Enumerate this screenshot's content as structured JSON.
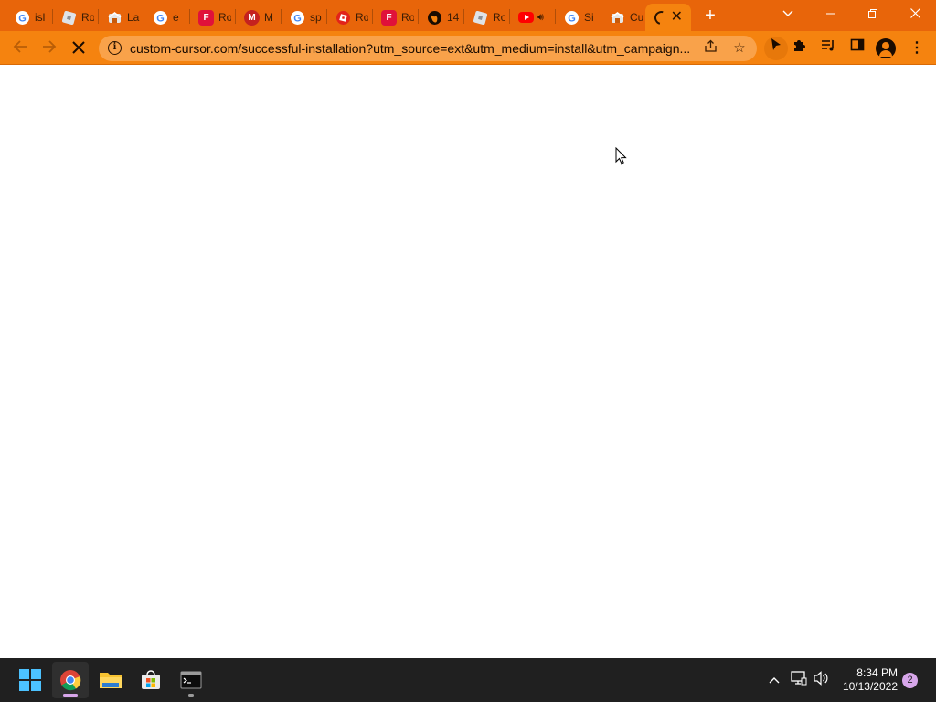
{
  "browser": {
    "tabs": [
      {
        "icon": "google-icon",
        "title": "isl"
      },
      {
        "icon": "roblox-icon",
        "title": "Ro"
      },
      {
        "icon": "extension-page-icon",
        "title": "La"
      },
      {
        "icon": "google-icon",
        "title": "e"
      },
      {
        "icon": "fandom-icon",
        "title": "Ro"
      },
      {
        "icon": "gmail-icon",
        "title": "M"
      },
      {
        "icon": "google-icon",
        "title": "sp"
      },
      {
        "icon": "roblox-red-icon",
        "title": "Ro"
      },
      {
        "icon": "fandom-icon",
        "title": "Ro"
      },
      {
        "icon": "globe-icon",
        "title": "14"
      },
      {
        "icon": "roblox-icon",
        "title": "Ro"
      },
      {
        "icon": "youtube-icon",
        "title": ""
      },
      {
        "icon": "google-icon",
        "title": "Si"
      },
      {
        "icon": "extension-page-icon",
        "title": "Cu"
      }
    ],
    "active_tab": {
      "icon": "loading-spinner-icon",
      "title": ""
    },
    "address_bar": {
      "url": "custom-cursor.com/successful-installation?utm_source=ext&utm_medium=install&utm_campaign..."
    }
  },
  "taskbar": {
    "clock_time": "8:34 PM",
    "clock_date": "10/13/2022",
    "notification_count": "2"
  },
  "colors": {
    "theme_orange": "#f5830f",
    "tabstrip_orange": "#e8650a",
    "taskbar": "#202020"
  }
}
